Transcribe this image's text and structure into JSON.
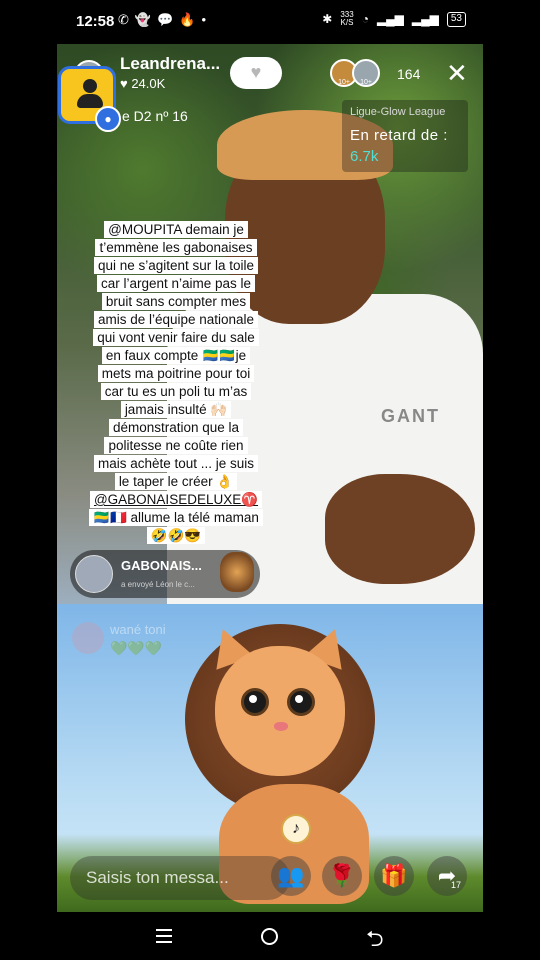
{
  "status_bar": {
    "time": "12:58",
    "left_icons": [
      "whatsapp-icon",
      "snapchat-icon",
      "chat-icon",
      "flame-icon",
      "dot-icon"
    ],
    "network_speed": "333\nK/S",
    "battery": "53"
  },
  "host": {
    "name": "Leandrena...",
    "likes": "♥ 24.0K",
    "tag": "e D2 nº 16"
  },
  "header": {
    "follow_icon": "heart-icon",
    "viewer_badges": [
      "10+",
      "10+"
    ],
    "viewer_count": "164",
    "close_icon": "close-icon"
  },
  "league_card": {
    "title": "Ligue-Glow League",
    "label": "En retard de :",
    "value": "6.7k"
  },
  "comment": {
    "lines": [
      "@MOUPITA  demain je",
      "t’emmène les gabonaises",
      "qui ne s’agitent sur la toile",
      "car l’argent n’aime pas le",
      "bruit sans compter mes",
      "amis de l’équipe nationale",
      "qui vont venir faire du sale",
      "en faux compte 🇬🇦🇬🇦je",
      "mets ma poitrine pour toi",
      "car tu es un poli tu m’as",
      "jamais insulté 🙌🏻",
      "démonstration que la",
      "politesse ne coûte rien",
      "mais achète tout ... je suis",
      "le taper le créer 👌",
      "@GABONAISEDELUXE♈",
      "🇬🇦🇫🇷  allume la télé maman",
      "🤣🤣😎"
    ]
  },
  "gift_notification": {
    "name": "GABONAIS...",
    "text": "a envoyé  Léon le c..."
  },
  "faded_notification": {
    "name": "wané toni",
    "hearts": "💚💚💚"
  },
  "bottom_bar": {
    "input_placeholder": "Saisis ton messa...",
    "buttons": [
      "people-icon",
      "rose-icon",
      "gift-icon",
      "share-icon"
    ],
    "share_count": "17"
  },
  "shirt_brand": "GANT",
  "colors": {
    "accent_teal": "#4ee0d4",
    "badge_yellow": "#f7c51e",
    "badge_blue": "#2f6fe0",
    "gift_pink": "#ff4f8e"
  }
}
